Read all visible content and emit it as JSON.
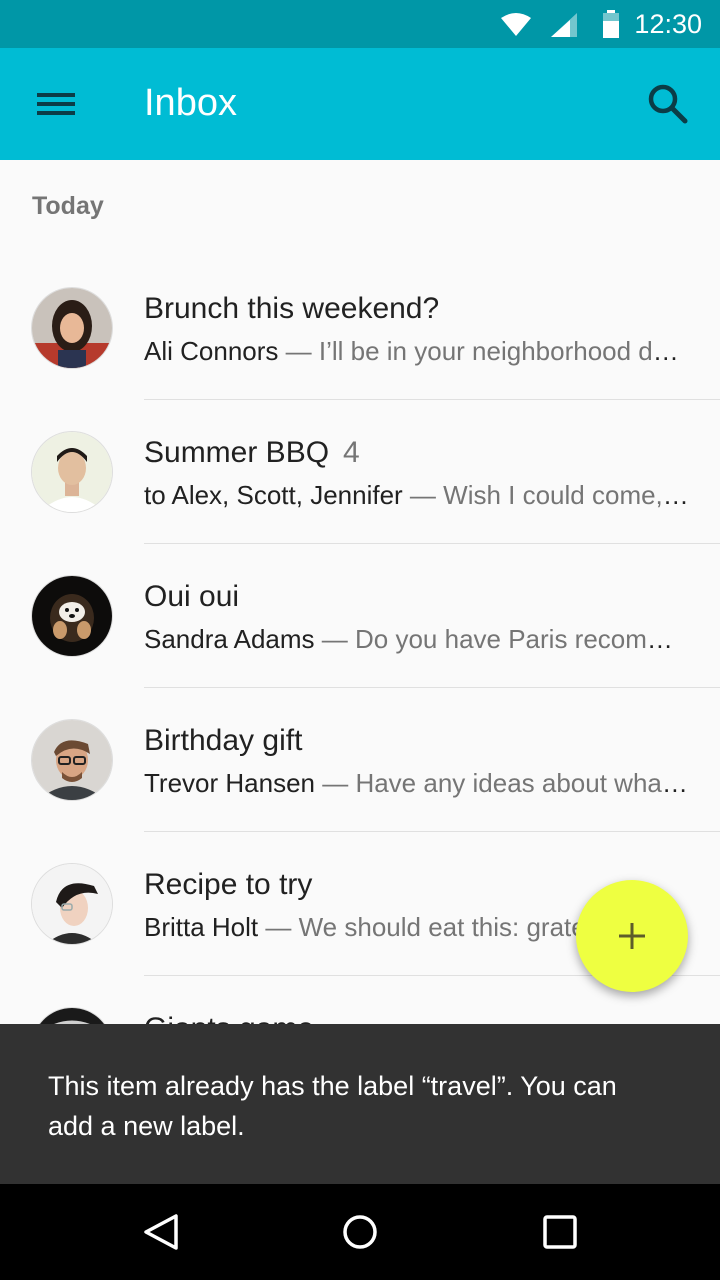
{
  "status_bar": {
    "time": "12:30",
    "icons": [
      "wifi-icon",
      "signal-icon",
      "battery-icon"
    ],
    "color": "#0097a7"
  },
  "app_bar": {
    "title": "Inbox",
    "menu_icon": "menu-icon",
    "search_icon": "search-icon",
    "color": "#00bcd4"
  },
  "inbox": {
    "section_label": "Today",
    "items": [
      {
        "subject": "Brunch this weekend?",
        "count": "",
        "from": "Ali Connors",
        "preview": " — I’ll be in your neighborhood doing errands this weekend. Do you want to grab brunch?"
      },
      {
        "subject": "Summer BBQ",
        "count": "4",
        "from": "to Alex, Scott, Jennifer",
        "preview": " — Wish I could come, but I’m out of town this weekend."
      },
      {
        "subject": "Oui oui",
        "count": "",
        "from": "Sandra Adams",
        "preview": " — Do you have Paris recommendations? Have you ever been?"
      },
      {
        "subject": "Birthday gift",
        "count": "",
        "from": "Trevor Hansen",
        "preview": " — Have any ideas about what we should get Heidi for her birthday?"
      },
      {
        "subject": "Recipe to try",
        "count": "",
        "from": "Britta Holt",
        "preview": " — We should eat this: grated squash. Corn and tomatillo tacos."
      },
      {
        "subject": "Giants game",
        "count": "",
        "from": "",
        "preview": ""
      }
    ]
  },
  "fab": {
    "icon": "add-icon",
    "color": "#eeff41"
  },
  "snackbar": {
    "message": "This item already has the label “travel”. You can add a new label."
  },
  "nav_bar": {
    "icons": [
      "back-icon",
      "home-icon",
      "recents-icon"
    ]
  }
}
